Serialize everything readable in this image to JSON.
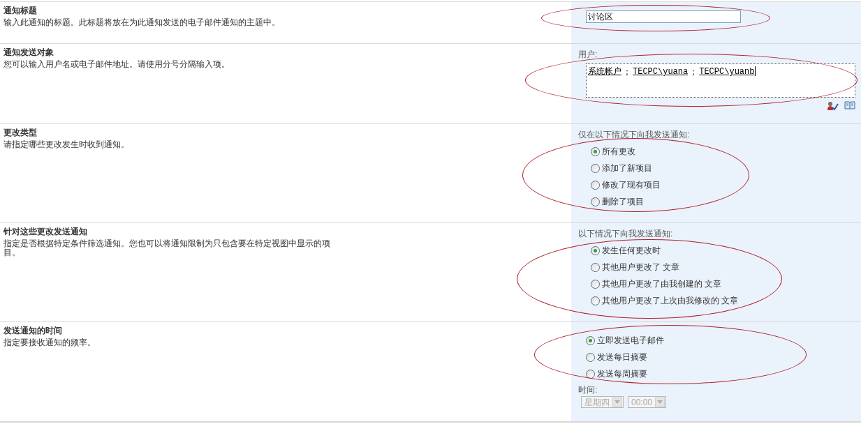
{
  "sections": [
    {
      "title": "通知标题",
      "description": "输入此通知的标题。此标题将放在为此通知发送的电子邮件通知的主题中。",
      "circled": true,
      "control": {
        "kind": "text_input",
        "value": "讨论区"
      }
    },
    {
      "title": "通知发送对象",
      "description": "您可以输入用户名或电子邮件地址。请使用分号分隔输入项。",
      "circled": true,
      "control": {
        "kind": "people_picker",
        "label": "用户:",
        "tokens": [
          {
            "kind": "user",
            "text": "系统帐户"
          },
          {
            "kind": "separator",
            "text": "；"
          },
          {
            "kind": "user",
            "text": "TECPC\\yuana"
          },
          {
            "kind": "separator",
            "text": "；"
          },
          {
            "kind": "user",
            "text": "TECPC\\yuanb"
          }
        ]
      }
    },
    {
      "title": "更改类型",
      "description": "请指定哪些更改发生时收到通知。",
      "circled": true,
      "control": {
        "kind": "radio_group",
        "label": "仅在以下情况下向我发送通知:",
        "options": [
          {
            "label": "所有更改",
            "selected": true
          },
          {
            "label": "添加了新项目",
            "selected": false
          },
          {
            "label": "修改了现有项目",
            "selected": false
          },
          {
            "label": "删除了项目",
            "selected": false
          }
        ]
      }
    },
    {
      "title": "针对这些更改发送通知",
      "description": "指定是否根据特定条件筛选通知。您也可以将通知限制为只包含要在特定视图中显示的项目。",
      "circled": true,
      "control": {
        "kind": "radio_group",
        "label": "以下情况下向我发送通知:",
        "options": [
          {
            "label": "发生任何更改时",
            "selected": true
          },
          {
            "label": "其他用户更改了 文章",
            "selected": false
          },
          {
            "label": "其他用户更改了由我创建的 文章",
            "selected": false
          },
          {
            "label": "其他用户更改了上次由我修改的 文章",
            "selected": false
          }
        ]
      }
    },
    {
      "title": "发送通知的时间",
      "description": "指定要接收通知的频率。",
      "circled": true,
      "control": {
        "kind": "radio_group",
        "options": [
          {
            "label": "立即发送电子邮件",
            "selected": true
          },
          {
            "label": "发送每日摘要",
            "selected": false
          },
          {
            "label": "发送每周摘要",
            "selected": false
          }
        ],
        "time": {
          "label": "时间:",
          "day": "星期四",
          "hour": "00:00",
          "disabled": true
        }
      }
    }
  ]
}
